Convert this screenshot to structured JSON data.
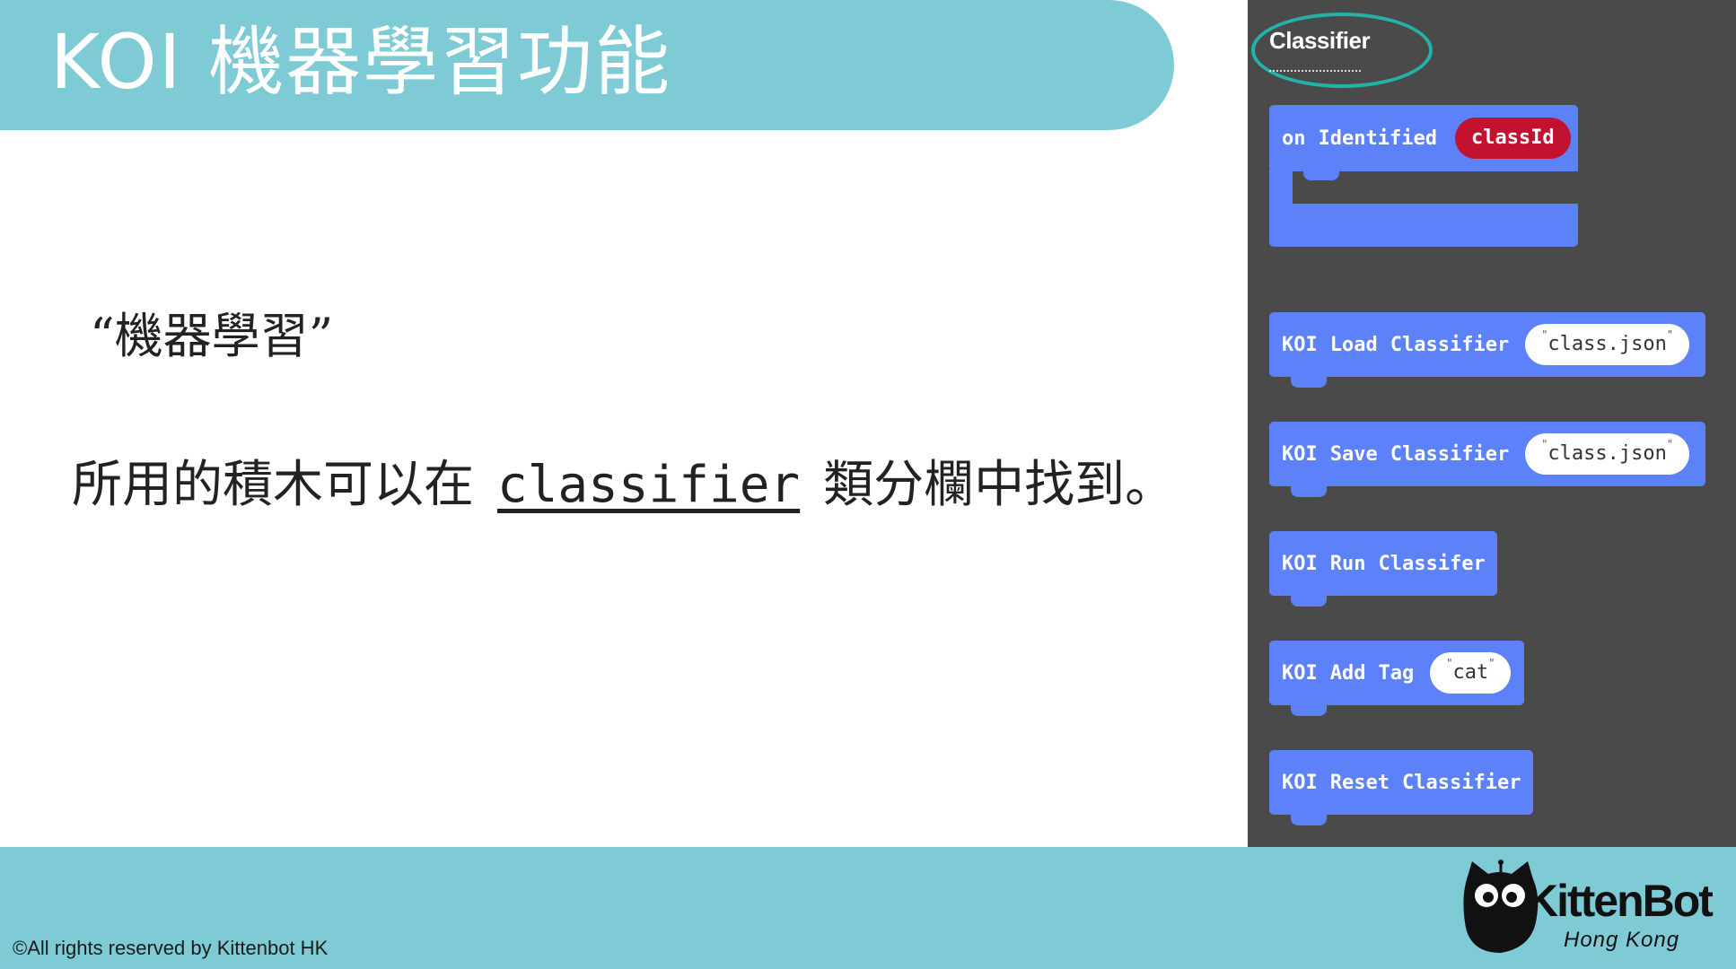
{
  "header": {
    "title": "KOI 機器學習功能"
  },
  "content": {
    "heading": "“機器學習”",
    "line_before": "所用的積木可以在",
    "keyword": "classifier",
    "line_after": "類分欄中找到。"
  },
  "panel": {
    "category_label": "Classifier",
    "blocks": [
      {
        "words": [
          "on",
          "Identified"
        ],
        "param": "classId",
        "param_type": "variable"
      },
      {
        "words": [
          "KOI",
          "Load",
          "Classifier"
        ],
        "param": "class.json",
        "param_type": "string"
      },
      {
        "words": [
          "KOI",
          "Save",
          "Classifier"
        ],
        "param": "class.json",
        "param_type": "string"
      },
      {
        "words": [
          "KOI",
          "Run",
          "Classifer"
        ]
      },
      {
        "words": [
          "KOI",
          "Add",
          "Tag"
        ],
        "param": "cat",
        "param_type": "string"
      },
      {
        "words": [
          "KOI",
          "Reset",
          "Classifier"
        ]
      }
    ],
    "colors": {
      "block": "#5c81f8",
      "variable": "#c3122f",
      "panel_bg": "#4a4a4a",
      "highlight": "#23b3a6"
    }
  },
  "footer": {
    "copyright": "©All rights reserved by Kittenbot HK",
    "logo_text": "KittenBot",
    "logo_sub": "Hong Kong"
  }
}
